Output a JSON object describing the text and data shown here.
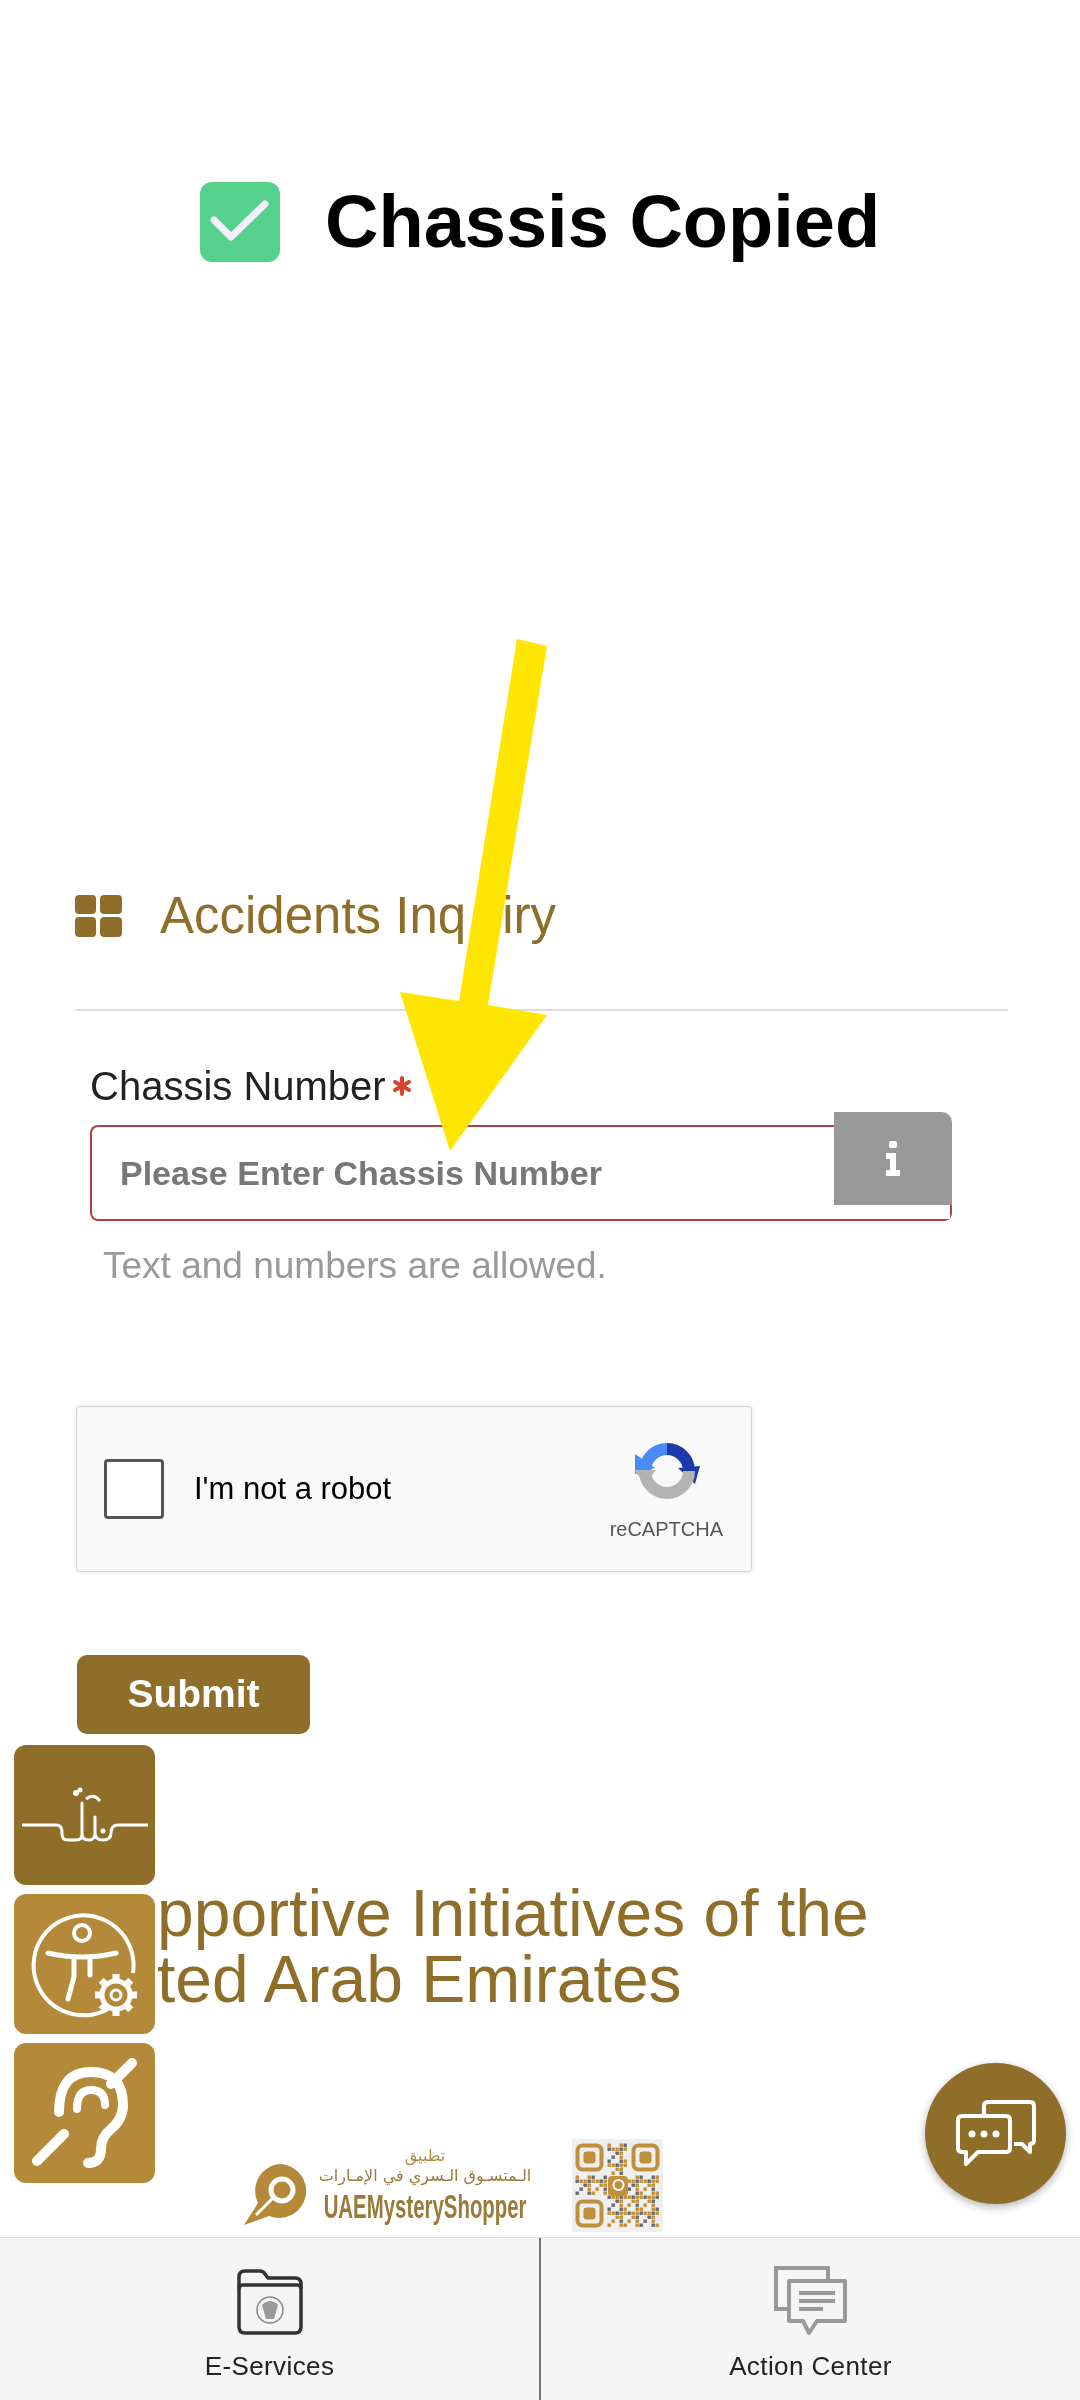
{
  "caption": {
    "title": "Chassis Copied"
  },
  "section": {
    "title_parts": [
      "Accidents Inq",
      "iry"
    ]
  },
  "form": {
    "field": {
      "label": "Chassis Number",
      "required": true,
      "placeholder": "Please Enter Chassis Number",
      "invalid": true,
      "hint": "Text and numbers are allowed."
    },
    "captcha": {
      "label": "I'm not a robot",
      "checked": false,
      "brand": "reCAPTCHA"
    },
    "submit": "Submit"
  },
  "initiatives": {
    "title_lines": [
      "pportive Initiatives of the",
      "ted Arab Emirates"
    ],
    "app": {
      "label": "تطبيق",
      "name_ar": "الـمتسـوق الـسري في الإمـارات",
      "name": "UAEMysteryShopper"
    }
  },
  "bottom_nav": [
    {
      "label": "E-Services",
      "kind": "folder"
    },
    {
      "label": "Action Center",
      "kind": "messages"
    }
  ]
}
